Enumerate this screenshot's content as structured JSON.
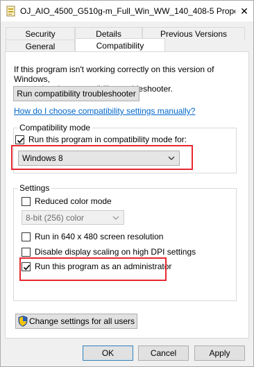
{
  "window": {
    "title": "OJ_AIO_4500_G510g-m_Full_Win_WW_140_408-5 Prope...",
    "close_label": "✕"
  },
  "tabs": {
    "row1": [
      {
        "label": "Security"
      },
      {
        "label": "Details"
      },
      {
        "label": "Previous Versions"
      }
    ],
    "row2": [
      {
        "label": "General"
      },
      {
        "label": "Compatibility",
        "active": true
      }
    ]
  },
  "compat": {
    "intro_line1": "If this program isn't working correctly on this version of Windows,",
    "intro_line2": "try running the compatibility troubleshooter.",
    "troubleshooter_button": "Run compatibility troubleshooter",
    "manual_link": "How do I choose compatibility settings manually?",
    "mode_group_label": "Compatibility mode",
    "mode_checkbox_label": "Run this program in compatibility mode for:",
    "mode_checkbox_checked": true,
    "mode_select_value": "Windows 8"
  },
  "settings": {
    "group_label": "Settings",
    "reduced_color_label": "Reduced color mode",
    "reduced_color_checked": false,
    "color_select_value": "8-bit (256) color",
    "res_640_label": "Run in 640 x 480 screen resolution",
    "res_640_checked": false,
    "dpi_label": "Disable display scaling on high DPI settings",
    "dpi_checked": false,
    "admin_label": "Run this program as an administrator",
    "admin_checked": true
  },
  "change_all_button": "Change settings for all users",
  "footer": {
    "ok": "OK",
    "cancel": "Cancel",
    "apply": "Apply"
  },
  "colors": {
    "highlight": "#e8262f",
    "link": "#0066cc"
  }
}
